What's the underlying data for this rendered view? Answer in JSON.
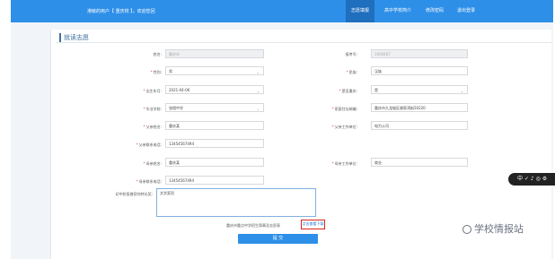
{
  "header": {
    "welcome": "港敏的用户【 重庆校 】，欢迎您回",
    "nav": [
      "志愿填报",
      "高中学校简介",
      "修改密码",
      "退出登录"
    ]
  },
  "section_title": "就读志愿",
  "form": {
    "name_label": "姓名:",
    "name_value": "重庆市",
    "exam_no_label": "报考号:",
    "exam_no_value": "1000467",
    "gender_label": "性别:",
    "gender_value": "男",
    "ethnicity_label": "民族:",
    "ethnicity_value": "汉族",
    "birth_label": "出生年月:",
    "birth_value": "2021-04-06",
    "cq_hukou_label": "是否重庆:",
    "cq_hukou_value": "是",
    "grad_school_label": "毕业学校:",
    "grad_school_value": "张相中学",
    "home_addr_label": "家庭住址邮编:",
    "home_addr_value": "重庆市九龙坡区谢家湾街50220",
    "father_name_label": "父亲姓名:",
    "father_name_value": "重庆某",
    "father_work_label": "父亲工作单位:",
    "father_work_value": "电力公司",
    "father_phone_label": "父亲联系电话:",
    "father_phone_value": "13454567494",
    "mother_name_label": "母亲姓名:",
    "mother_name_value": "重庆某",
    "mother_work_label": "母亲工作单位:",
    "mother_work_value": "商业",
    "mother_phone_label": "母亲联系电话:",
    "mother_phone_value": "13454567494",
    "skills_label": "初中阶段曾获何特长奖:",
    "skills_value": "文学奖项"
  },
  "note_text": "重庆市重点中学招生简章及志愿表",
  "download_label": "点击查看下载",
  "submit_label": "提 交",
  "side_tool_text": "中 ✓ ♪ ◎ ⚙",
  "watermark_text": "学校情报站"
}
